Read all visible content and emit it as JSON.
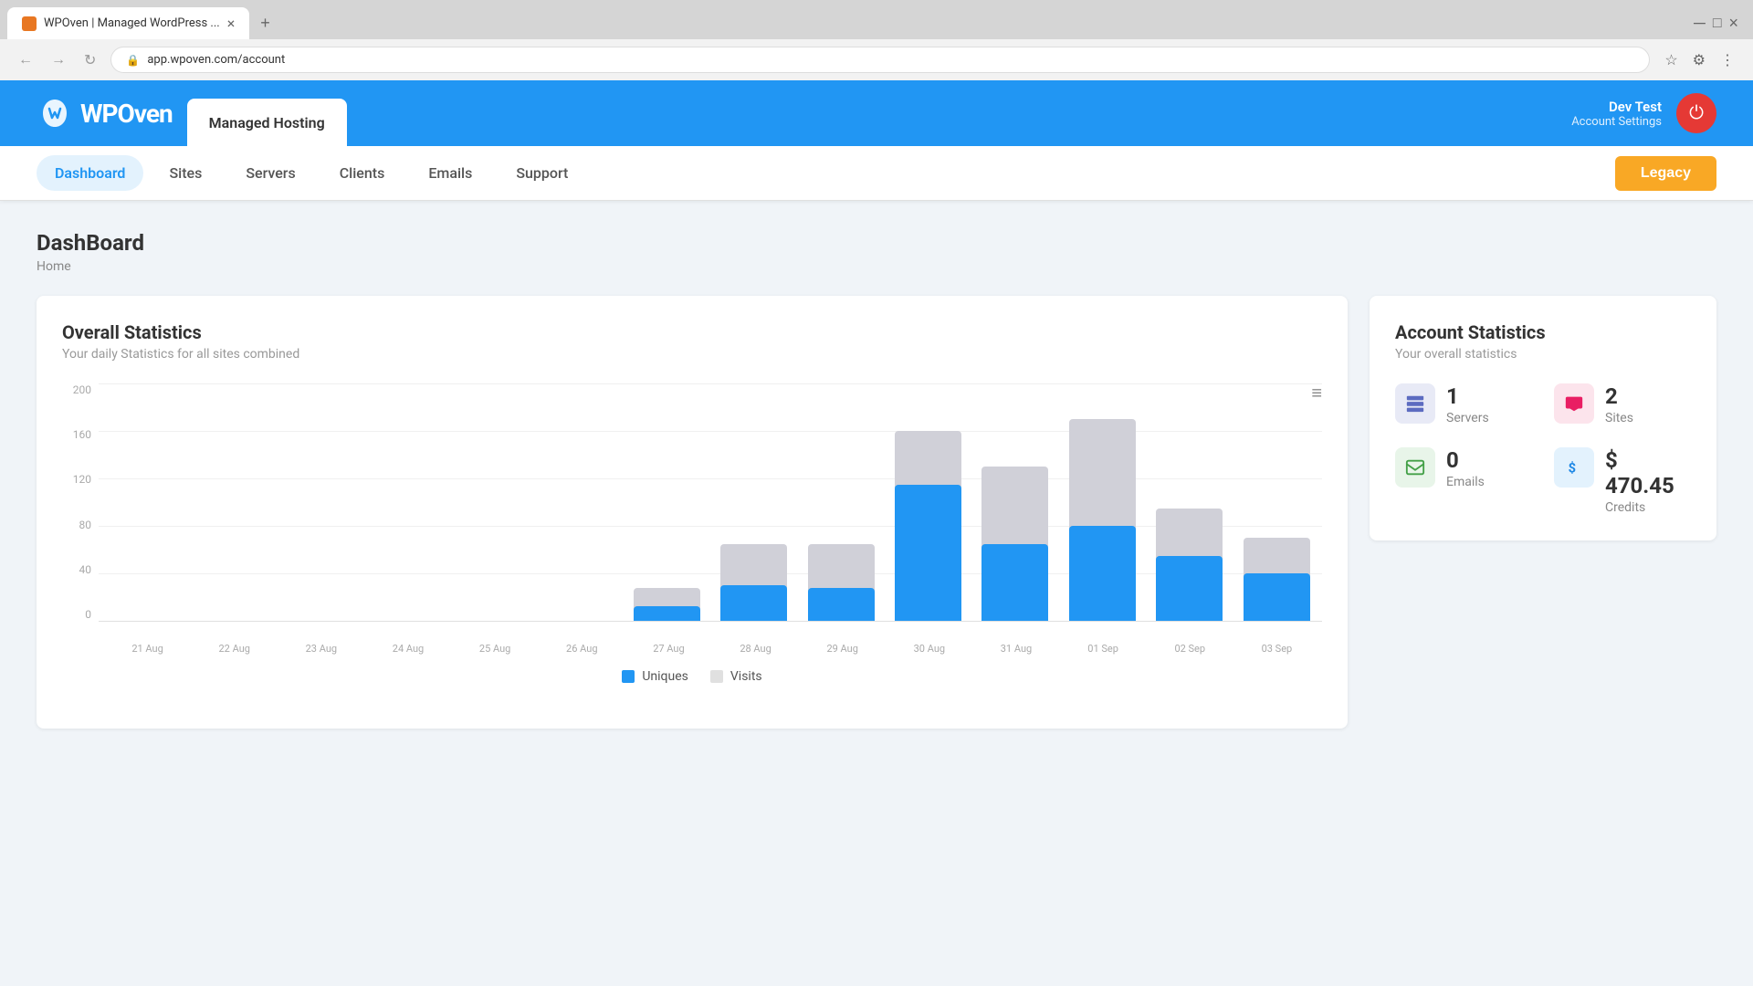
{
  "browser": {
    "tab_title": "WPOven | Managed WordPress ...",
    "url": "app.wpoven.com/account",
    "new_tab_icon": "+"
  },
  "header": {
    "logo_text": "WPOven",
    "managed_hosting_label": "Managed Hosting",
    "account_name": "Dev Test",
    "account_settings_label": "Account Settings"
  },
  "nav": {
    "items": [
      {
        "label": "Dashboard",
        "active": true
      },
      {
        "label": "Sites",
        "active": false
      },
      {
        "label": "Servers",
        "active": false
      },
      {
        "label": "Clients",
        "active": false
      },
      {
        "label": "Emails",
        "active": false
      },
      {
        "label": "Support",
        "active": false
      }
    ],
    "legacy_button": "Legacy"
  },
  "page": {
    "title": "DashBoard",
    "breadcrumb": "Home"
  },
  "overall_stats": {
    "title": "Overall Statistics",
    "subtitle": "Your daily Statistics for all sites combined",
    "y_labels": [
      "200",
      "160",
      "120",
      "80",
      "40",
      "0"
    ],
    "x_labels": [
      "21 Aug",
      "22 Aug",
      "23 Aug",
      "24 Aug",
      "25 Aug",
      "26 Aug",
      "27 Aug",
      "28 Aug",
      "29 Aug",
      "30 Aug",
      "31 Aug",
      "01 Sep",
      "02 Sep",
      "03 Sep"
    ],
    "bars": [
      {
        "visits": 0,
        "uniques": 0
      },
      {
        "visits": 0,
        "uniques": 0
      },
      {
        "visits": 0,
        "uniques": 0
      },
      {
        "visits": 0,
        "uniques": 0
      },
      {
        "visits": 0,
        "uniques": 0
      },
      {
        "visits": 0,
        "uniques": 0
      },
      {
        "visits": 28,
        "uniques": 12
      },
      {
        "visits": 65,
        "uniques": 30
      },
      {
        "visits": 65,
        "uniques": 28
      },
      {
        "visits": 160,
        "uniques": 115
      },
      {
        "visits": 130,
        "uniques": 65
      },
      {
        "visits": 170,
        "uniques": 80
      },
      {
        "visits": 95,
        "uniques": 55
      },
      {
        "visits": 70,
        "uniques": 40
      }
    ],
    "legend_uniques": "Uniques",
    "legend_visits": "Visits",
    "max_value": 200
  },
  "account_stats": {
    "title": "Account Statistics",
    "subtitle": "Your overall statistics",
    "servers_count": "1",
    "servers_label": "Servers",
    "sites_count": "2",
    "sites_label": "Sites",
    "emails_count": "0",
    "emails_label": "Emails",
    "credits_value": "$ 470.45",
    "credits_label": "Credits"
  }
}
